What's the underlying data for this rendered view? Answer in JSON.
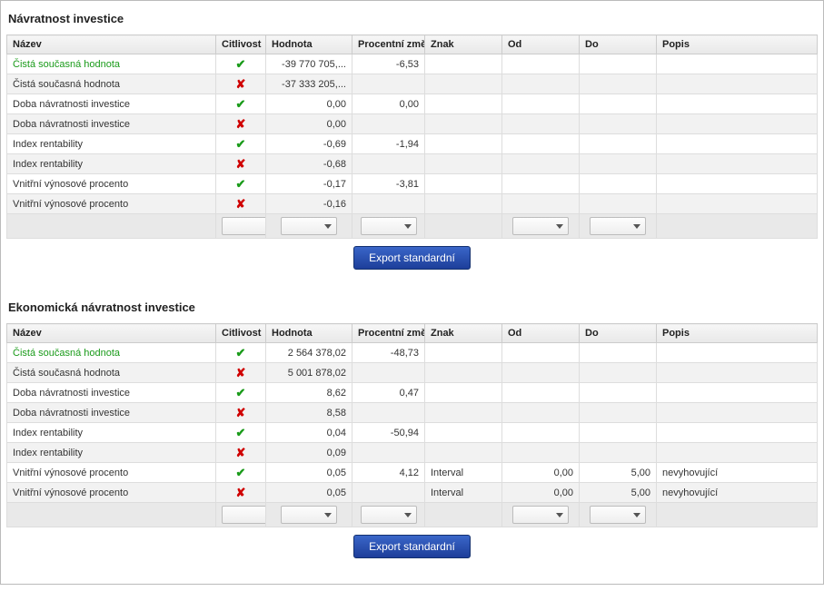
{
  "columns": {
    "nazev": "Název",
    "citlivost": "Citlivost",
    "hodnota": "Hodnota",
    "procentni_zmena": "Procentní změna",
    "znak": "Znak",
    "od": "Od",
    "do": "Do",
    "popis": "Popis"
  },
  "export_label": "Export standardní",
  "sections": [
    {
      "title": "Návratnost investice",
      "rows": [
        {
          "nazev": "Čistá současná hodnota",
          "green": true,
          "cit": true,
          "hodnota": "-39 770 705,...",
          "proc": "-6,53",
          "znak": "",
          "od": "",
          "do": "",
          "popis": ""
        },
        {
          "nazev": "Čistá současná hodnota",
          "green": false,
          "cit": false,
          "hodnota": "-37 333 205,...",
          "proc": "",
          "znak": "",
          "od": "",
          "do": "",
          "popis": ""
        },
        {
          "nazev": "Doba návratnosti investice",
          "green": false,
          "cit": true,
          "hodnota": "0,00",
          "proc": "0,00",
          "znak": "",
          "od": "",
          "do": "",
          "popis": ""
        },
        {
          "nazev": "Doba návratnosti investice",
          "green": false,
          "cit": false,
          "hodnota": "0,00",
          "proc": "",
          "znak": "",
          "od": "",
          "do": "",
          "popis": ""
        },
        {
          "nazev": "Index rentability",
          "green": false,
          "cit": true,
          "hodnota": "-0,69",
          "proc": "-1,94",
          "znak": "",
          "od": "",
          "do": "",
          "popis": ""
        },
        {
          "nazev": "Index rentability",
          "green": false,
          "cit": false,
          "hodnota": "-0,68",
          "proc": "",
          "znak": "",
          "od": "",
          "do": "",
          "popis": ""
        },
        {
          "nazev": "Vnitřní výnosové procento",
          "green": false,
          "cit": true,
          "hodnota": "-0,17",
          "proc": "-3,81",
          "znak": "",
          "od": "",
          "do": "",
          "popis": ""
        },
        {
          "nazev": "Vnitřní výnosové procento",
          "green": false,
          "cit": false,
          "hodnota": "-0,16",
          "proc": "",
          "znak": "",
          "od": "",
          "do": "",
          "popis": ""
        }
      ]
    },
    {
      "title": "Ekonomická návratnost investice",
      "rows": [
        {
          "nazev": "Čistá současná hodnota",
          "green": true,
          "cit": true,
          "hodnota": "2 564 378,02",
          "proc": "-48,73",
          "znak": "",
          "od": "",
          "do": "",
          "popis": ""
        },
        {
          "nazev": "Čistá současná hodnota",
          "green": false,
          "cit": false,
          "hodnota": "5 001 878,02",
          "proc": "",
          "znak": "",
          "od": "",
          "do": "",
          "popis": ""
        },
        {
          "nazev": "Doba návratnosti investice",
          "green": false,
          "cit": true,
          "hodnota": "8,62",
          "proc": "0,47",
          "znak": "",
          "od": "",
          "do": "",
          "popis": ""
        },
        {
          "nazev": "Doba návratnosti investice",
          "green": false,
          "cit": false,
          "hodnota": "8,58",
          "proc": "",
          "znak": "",
          "od": "",
          "do": "",
          "popis": ""
        },
        {
          "nazev": "Index rentability",
          "green": false,
          "cit": true,
          "hodnota": "0,04",
          "proc": "-50,94",
          "znak": "",
          "od": "",
          "do": "",
          "popis": ""
        },
        {
          "nazev": "Index rentability",
          "green": false,
          "cit": false,
          "hodnota": "0,09",
          "proc": "",
          "znak": "",
          "od": "",
          "do": "",
          "popis": ""
        },
        {
          "nazev": "Vnitřní výnosové procento",
          "green": false,
          "cit": true,
          "hodnota": "0,05",
          "proc": "4,12",
          "znak": "Interval",
          "od": "0,00",
          "do": "5,00",
          "popis": "nevyhovující"
        },
        {
          "nazev": "Vnitřní výnosové procento",
          "green": false,
          "cit": false,
          "hodnota": "0,05",
          "proc": "",
          "znak": "Interval",
          "od": "0,00",
          "do": "5,00",
          "popis": "nevyhovující"
        }
      ]
    }
  ]
}
